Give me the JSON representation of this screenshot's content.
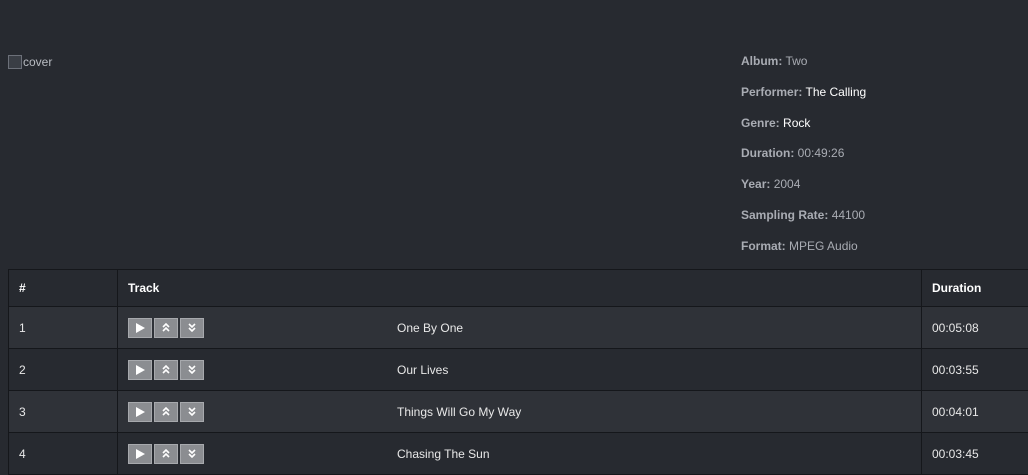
{
  "cover": {
    "alt": "cover"
  },
  "album_info": [
    {
      "key": "Album:",
      "value": "Two",
      "bright": false
    },
    {
      "key": "Performer:",
      "value": "The Calling",
      "bright": true
    },
    {
      "key": "Genre:",
      "value": "Rock",
      "bright": true
    },
    {
      "key": "Duration:",
      "value": "00:49:26",
      "bright": false
    },
    {
      "key": "Year:",
      "value": "2004",
      "bright": false
    },
    {
      "key": "Sampling Rate:",
      "value": "44100",
      "bright": false
    },
    {
      "key": "Format:",
      "value": "MPEG Audio",
      "bright": false
    }
  ],
  "table": {
    "headers": {
      "number": "#",
      "track": "Track",
      "duration": "Duration"
    },
    "rows": [
      {
        "number": "1",
        "title": "One By One",
        "duration": "00:05:08"
      },
      {
        "number": "2",
        "title": "Our Lives",
        "duration": "00:03:55"
      },
      {
        "number": "3",
        "title": "Things Will Go My Way",
        "duration": "00:04:01"
      },
      {
        "number": "4",
        "title": "Chasing The Sun",
        "duration": "00:03:45"
      }
    ]
  },
  "icons": {
    "play": "play-icon",
    "up": "double-chevron-up-icon",
    "down": "double-chevron-down-icon"
  }
}
